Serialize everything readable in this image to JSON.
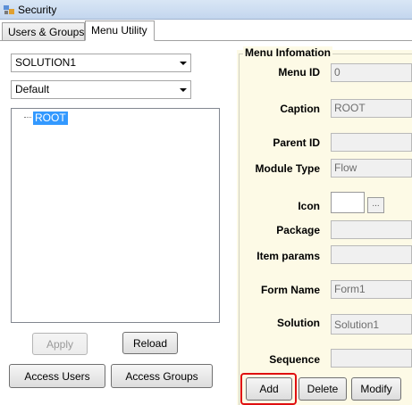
{
  "window": {
    "title": "Security"
  },
  "tabs": [
    {
      "label": "Users & Groups"
    },
    {
      "label": "Menu Utility"
    }
  ],
  "left": {
    "solution_combo": "SOLUTION1",
    "layout_combo": "Default",
    "tree_root": "ROOT",
    "apply_label": "Apply",
    "reload_label": "Reload",
    "access_users_label": "Access Users",
    "access_groups_label": "Access Groups"
  },
  "menu_info": {
    "group_title": "Menu Infomation",
    "menu_id_label": "Menu ID",
    "menu_id_value": "0",
    "caption_label": "Caption",
    "caption_value": "ROOT",
    "parent_id_label": "Parent ID",
    "parent_id_value": "",
    "module_type_label": "Module Type",
    "module_type_value": "Flow",
    "icon_label": "Icon",
    "icon_browse": "...",
    "package_label": "Package",
    "package_value": "",
    "item_params_label": "Item params",
    "item_params_value": "",
    "form_name_label": "Form Name",
    "form_name_value": "Form1",
    "solution_label": "Solution",
    "solution_value": "Solution1",
    "sequence_label": "Sequence",
    "sequence_value": ""
  },
  "actions": {
    "add_label": "Add",
    "delete_label": "Delete",
    "modify_label": "Modify"
  },
  "colors": {
    "panel_bg": "#fdfae6",
    "selection": "#3399ff",
    "highlight_box": "#e01010"
  }
}
